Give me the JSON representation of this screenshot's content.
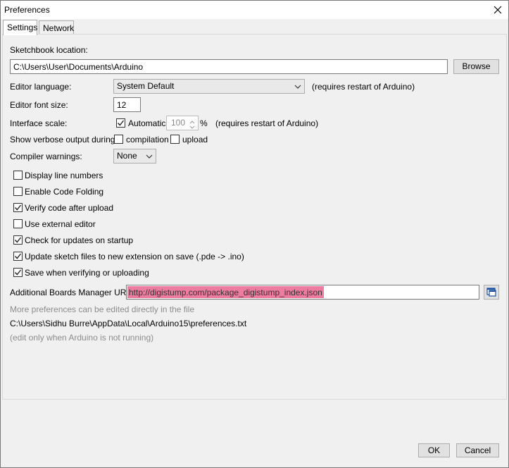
{
  "window": {
    "title": "Preferences"
  },
  "tabs": [
    {
      "label": "Settings"
    },
    {
      "label": "Network"
    }
  ],
  "settings": {
    "sketchbook_label": "Sketchbook location:",
    "sketchbook_path": "C:\\Users\\User\\Documents\\Arduino",
    "browse_label": "Browse",
    "editor_language_label": "Editor language:",
    "editor_language_value": "System Default",
    "restart_note": "(requires restart of Arduino)",
    "font_size_label": "Editor font size:",
    "font_size_value": "12",
    "interface_scale_label": "Interface scale:",
    "automatic_label": "Automatic",
    "scale_value": "100",
    "percent": "%",
    "scale_restart_note": "(requires restart of Arduino)",
    "verbose_label": "Show verbose output during:",
    "compilation_label": "compilation",
    "upload_label": "upload",
    "warnings_label": "Compiler warnings:",
    "warnings_value": "None",
    "checkboxes": [
      {
        "label": "Display line numbers",
        "checked": false
      },
      {
        "label": "Enable Code Folding",
        "checked": false
      },
      {
        "label": "Verify code after upload",
        "checked": true
      },
      {
        "label": "Use external editor",
        "checked": false
      },
      {
        "label": "Check for updates on startup",
        "checked": true
      },
      {
        "label": "Update sketch files to new extension on save (.pde -> .ino)",
        "checked": true
      },
      {
        "label": "Save when verifying or uploading",
        "checked": true
      }
    ],
    "boards_url_label": "Additional Boards Manager URLs:",
    "boards_url_value": "http://digistump.com/package_digistump_index.json",
    "more_prefs_note": "More preferences can be edited directly in the file",
    "prefs_path": "C:\\Users\\Sidhu Burre\\AppData\\Local\\Arduino15\\preferences.txt",
    "edit_note": "(edit only when Arduino is not running)"
  },
  "footer": {
    "ok_label": "OK",
    "cancel_label": "Cancel"
  }
}
